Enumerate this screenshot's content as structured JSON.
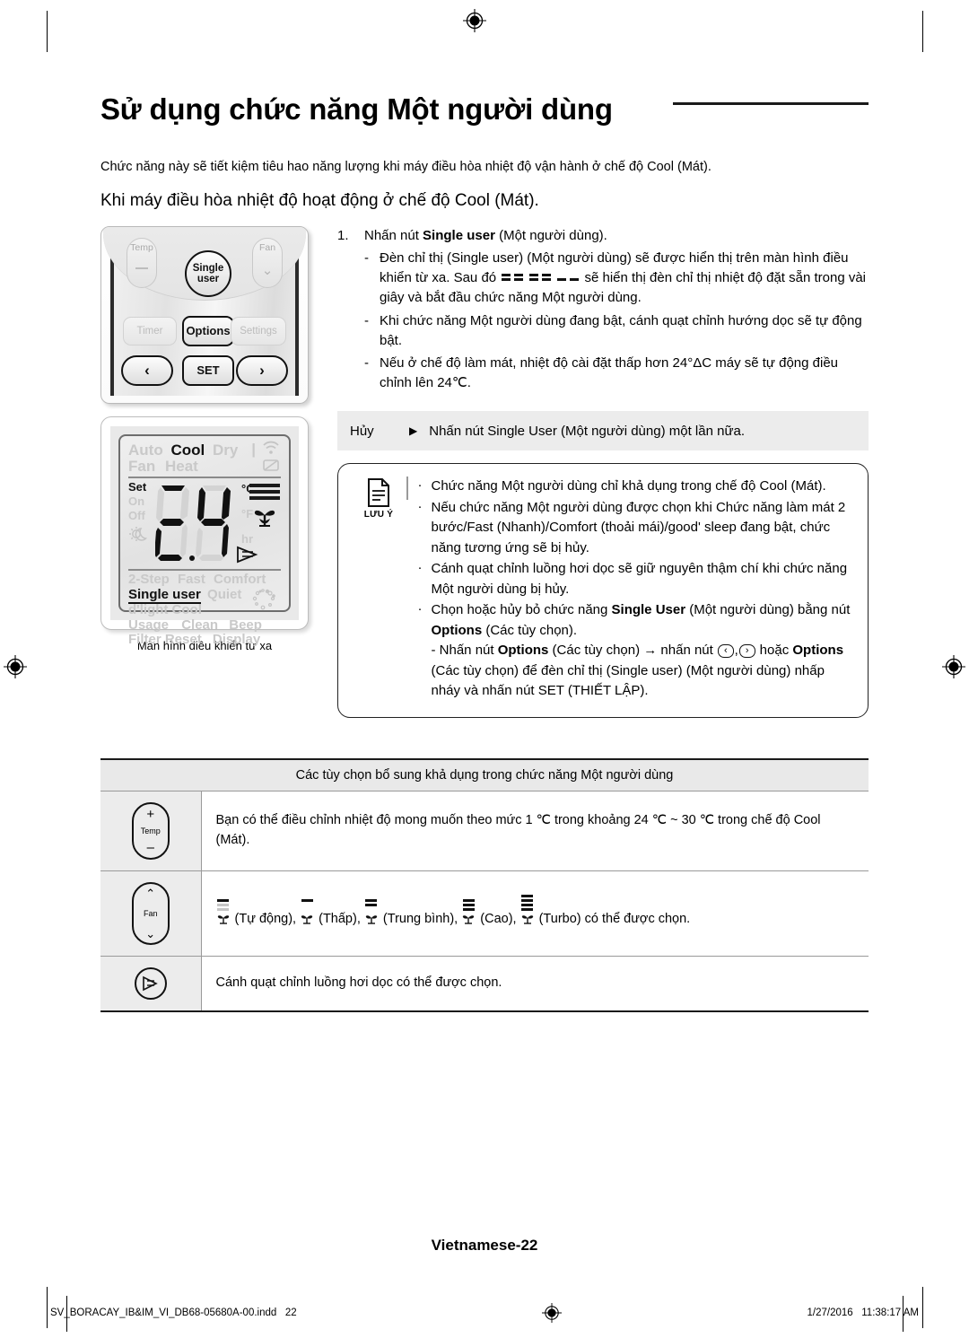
{
  "header": {
    "title": "Sử dụng chức năng Một người dùng",
    "intro": "Chức năng này sẽ tiết kiệm tiêu hao năng lượng khi máy điều hòa nhiệt độ vận hành ở chế độ Cool (Mát).",
    "subhead": "Khi máy điều hòa nhiệt độ hoạt động ở chế độ Cool (Mát)."
  },
  "remote": {
    "temp_label": "Temp",
    "fan_label": "Fan",
    "single_user_line1": "Single",
    "single_user_line2": "user",
    "timer_label": "Timer",
    "options_label": "Options",
    "settings_label": "Settings",
    "set_label": "SET",
    "left_arrow": "‹",
    "right_arrow": "›"
  },
  "lcd": {
    "mode_auto": "Auto",
    "mode_cool": "Cool",
    "mode_dry": "Dry",
    "mode_fan": "Fan",
    "mode_heat": "Heat",
    "set": "Set",
    "on": "On",
    "off": "Off",
    "temperature": "24",
    "unit_c": "°C",
    "unit_f": "°F",
    "unit_hr": "hr",
    "opt_2step": "2-Step",
    "opt_fast": "Fast",
    "opt_comfort": "Comfort",
    "opt_single_user": "Single user",
    "opt_quiet": "Quiet",
    "opt_dlight_cool": "d'light Cool",
    "opt_usage": "Usage",
    "opt_clean": "Clean",
    "opt_beep": "Beep",
    "opt_filter_reset": "Filter Reset",
    "opt_display": "Display"
  },
  "caption": "Màn hình điều khiển từ xa",
  "steps": [
    {
      "number": "1.",
      "text_before": "Nhấn nút ",
      "bold": "Single user",
      "text_after": " (Một người dùng)."
    }
  ],
  "substeps": [
    {
      "dash": "-",
      "part1": "Đèn chỉ thị (Single user) (Một người dùng) sẽ được hiển thị trên màn hình điều khiển từ xa. Sau đó ",
      "part2": " sẽ hiển thị đèn chỉ thị nhiệt độ đặt sẵn trong vài giây và bắt đầu chức năng Một người dùng."
    },
    {
      "dash": "-",
      "part1": "Khi chức năng Một người dùng đang bật, cánh quạt chỉnh hướng dọc sẽ tự động bật.",
      "part2": ""
    },
    {
      "dash": "-",
      "part1": "Nếu ở chế độ làm mát, nhiệt độ cài đặt thấp hơn 24°ΔC máy sẽ tự động điều chỉnh lên 24℃.",
      "part2": ""
    }
  ],
  "cancel": {
    "label": "Hủy",
    "arrow": "▶",
    "text": "Nhấn nút Single User (Một người dùng) một lần nữa."
  },
  "note": {
    "icon_caption": "LƯU Ý",
    "bullets": [
      {
        "bullet": "·",
        "text": "Chức năng Một người dùng chỉ khả dụng trong chế độ Cool (Mát)."
      },
      {
        "bullet": "·",
        "text": "Nếu chức năng Một người dùng được chọn khi Chức năng làm mát 2 bước/Fast (Nhanh)/Comfort (thoải mái)/good' sleep đang bật, chức năng tương ứng sẽ bị hủy."
      },
      {
        "bullet": "·",
        "text": "Cánh quạt chỉnh luồng hơi dọc sẽ giữ nguyên thậm chí khi chức năng Một người dùng bị hủy."
      }
    ],
    "last_bullet": {
      "bullet": "·",
      "p1": "Chọn hoặc hủy bỏ chức năng ",
      "b1": "Single User",
      "p2": " (Một người dùng) bằng nút ",
      "b2": "Options",
      "p3": " (Các tùy chọn).",
      "sub_p1": "- Nhấn nút ",
      "sub_b1": "Options",
      "sub_p2": " (Các tùy chọn) ",
      "sub_arrow": "→",
      "sub_p3": " nhấn nút ",
      "key_left": "‹",
      "key_comma": ",",
      "key_right": "›",
      "sub_p4": " hoặc ",
      "sub_b2": "Options",
      "sub_p5": " (Các tùy chọn) để đèn chỉ thị (Single user) (Một người dùng) nhấp nháy và nhấn nút SET (THIẾT LẬP)."
    }
  },
  "table": {
    "header": "Các tùy chọn bổ sung khả dụng trong chức năng Một người dùng",
    "rows": [
      {
        "icon_name": "temp-button-icon",
        "icon_label": "Temp",
        "icon_plus": "+",
        "icon_minus": "–",
        "text": "Bạn có thể điều chỉnh nhiệt độ mong muốn theo mức 1 ℃ trong khoảng 24 ℃ ~ 30 ℃ trong chế độ Cool (Mát)."
      },
      {
        "icon_name": "fan-button-icon",
        "icon_label": "Fan",
        "icon_up": "⌃",
        "icon_down": "⌄",
        "text_parts": [
          " (Tự động), ",
          " (Thấp), ",
          " (Trung bình), ",
          " (Cao), ",
          " (Turbo) có thể được chọn."
        ],
        "levels": [
          "auto",
          "low",
          "medium",
          "high",
          "turbo"
        ]
      },
      {
        "icon_name": "vane-button-icon",
        "text": "Cánh quạt chỉnh luồng hơi dọc có thể được chọn."
      }
    ]
  },
  "footer": {
    "page_label": "Vietnamese-22",
    "file_name": "SV_BORACAY_IB&IM_VI_DB68-05680A-00.indd",
    "file_page": "22",
    "date": "1/27/2016",
    "time": "11:38:17 AM"
  }
}
